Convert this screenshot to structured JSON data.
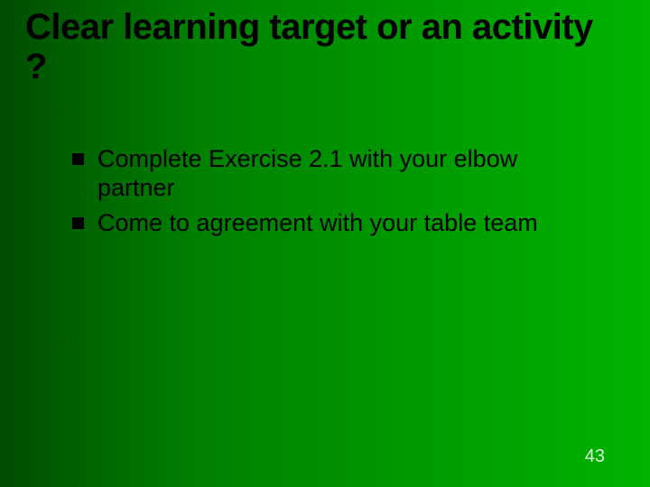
{
  "slide": {
    "title": "Clear learning target or an activity ?",
    "bullets": [
      "Complete Exercise 2.1  with your elbow partner",
      "Come to agreement with your table team"
    ],
    "pageNumber": "43"
  }
}
